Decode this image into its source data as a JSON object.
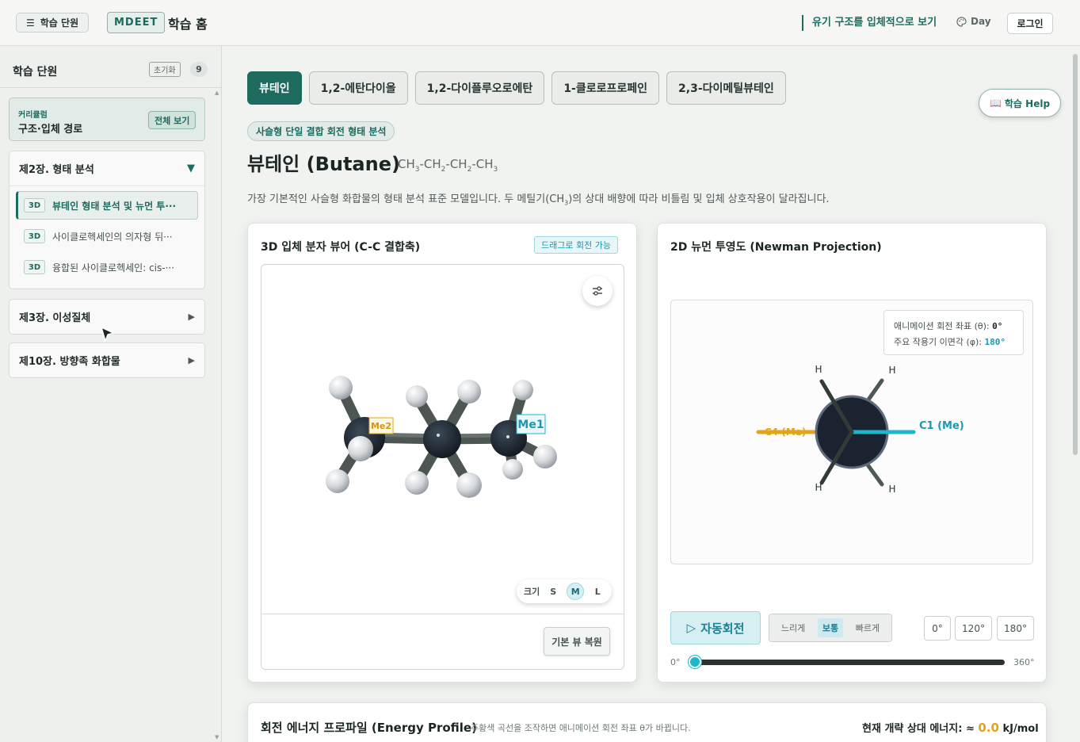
{
  "header": {
    "menu_label": "학습 단원",
    "brand": "MDEET",
    "home_title": "학습 홈",
    "subject_tag": "유기 구조를 입체적으로 보기",
    "theme_label": "Day",
    "login_label": "로그인"
  },
  "sidebar": {
    "title": "학습 단원",
    "reset_label": "초기화",
    "count": "9",
    "curriculum": {
      "label": "커리큘럼",
      "name": "구조·입체 경로",
      "view_all": "전체 보기"
    },
    "chapters": [
      {
        "title": "제2장. 형태 분석",
        "expanded": true,
        "lessons": [
          {
            "badge": "3D",
            "label": "뷰테인 형태 분석 및 뉴먼 투···",
            "active": true
          },
          {
            "badge": "3D",
            "label": "사이클로헥세인의 의자형 뒤···",
            "active": false
          },
          {
            "badge": "3D",
            "label": "융합된 사이클로헥세인: cis-···",
            "active": false
          }
        ]
      },
      {
        "title": "제3장. 이성질체",
        "expanded": false
      },
      {
        "title": "제10장. 방향족 화합물",
        "expanded": false
      }
    ]
  },
  "tabs": [
    "뷰테인",
    "1,2-에탄다이올",
    "1,2-다이플루오로에탄",
    "1-클로로프로페인",
    "2,3-다이메틸뷰테인"
  ],
  "active_tab": 0,
  "help_label": "학습 Help",
  "category_pill": "사슬형 단일 결합 회전 형태 분석",
  "molecule": {
    "title": "뷰테인 (Butane)",
    "formula_parts": [
      "CH",
      "3",
      "-CH",
      "2",
      "-CH",
      "2",
      "-CH",
      "3"
    ],
    "description_pre": "가장 기본적인 사슬형 화합물의 형태 분석 표준 모델입니다. 두 메틸기(CH",
    "description_sub": "3",
    "description_post": ")의 상대 배향에 따라 비틀림 및 입체 상호작용이 달라집니다."
  },
  "viewer3d": {
    "title": "3D 입체 분자 뷰어 (C-C 결합축)",
    "drag_hint": "드래그로 회전 가능",
    "label_me1": "Me1",
    "label_me2": "Me2",
    "size_label": "크기",
    "size_options": [
      "S",
      "M",
      "L"
    ],
    "size_selected": "M",
    "reset_view": "기본 뷰 복원"
  },
  "newman": {
    "title": "2D 뉴먼 투영도 (Newman Projection)",
    "theta_label": "애니메이션 회전 좌표 (θ):",
    "theta_value": "0°",
    "phi_label": "주요 작용기 이면각 (φ):",
    "phi_value": "180°",
    "front_label": "C1 (Me)",
    "back_label": "C4 (Me)",
    "h_label": "H",
    "auto_rotate": "자동회전",
    "speeds": [
      "느리게",
      "보통",
      "빠르게"
    ],
    "speed_selected": "보통",
    "angle_presets": [
      "0°",
      "120°",
      "180°"
    ],
    "slider_min": "0°",
    "slider_max": "360°",
    "slider_value": 0
  },
  "energy": {
    "title": "회전 에너지 프로파일 (Energy Profile)",
    "hint": "주황색 곡선을 조작하면 애니메이션 회전 좌표 θ가 바뀝니다.",
    "current_label": "현재 개략 상대 에너지: ≈",
    "current_value": "0.0",
    "unit": "kJ/mol"
  },
  "colors": {
    "accent": "#1d6b5f",
    "cyan": "#1eb6cf",
    "orange": "#e2a51a"
  }
}
